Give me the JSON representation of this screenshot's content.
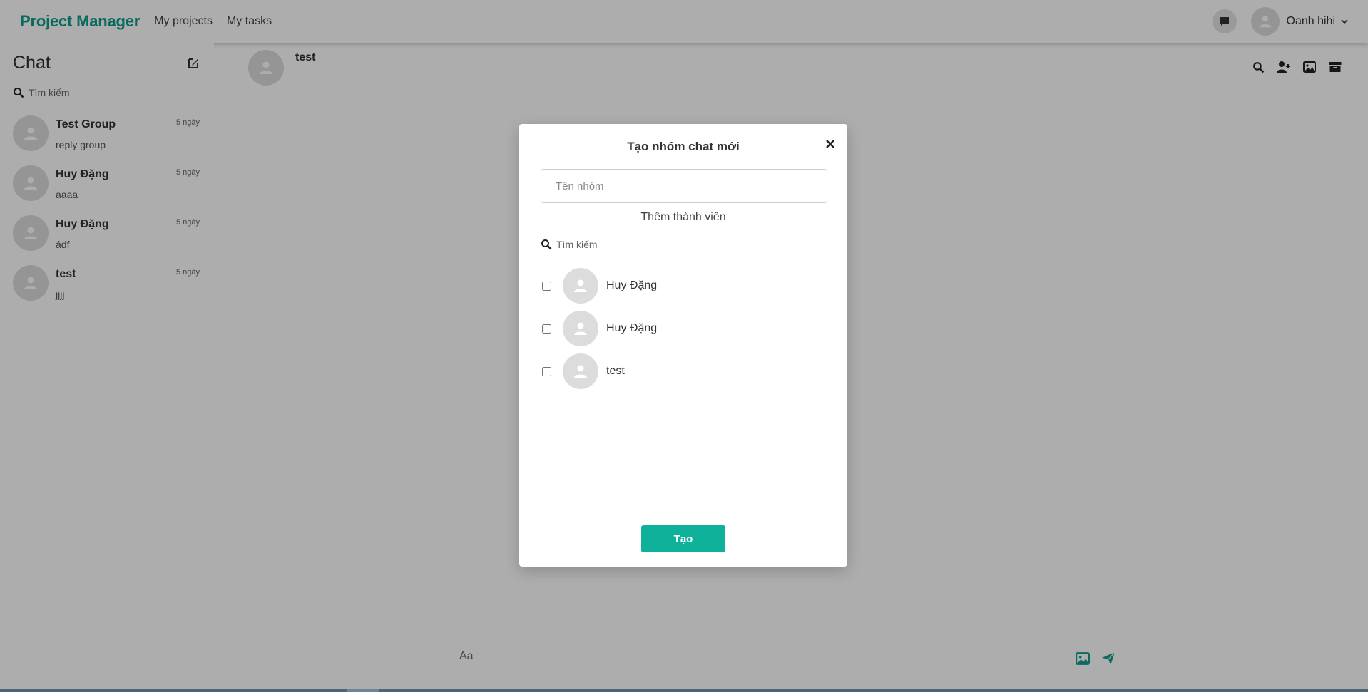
{
  "app": {
    "brand": "Project Manager"
  },
  "nav": {
    "links": [
      {
        "label": "My projects"
      },
      {
        "label": "My tasks"
      }
    ],
    "user_name": "Oanh hihi"
  },
  "sidebar": {
    "title": "Chat",
    "search_label": "Tìm kiếm",
    "conversations": [
      {
        "name": "Test Group",
        "last_message": "reply group",
        "time": "5 ngày"
      },
      {
        "name": "Huy Đặng",
        "last_message": "aaaa",
        "time": "5 ngày"
      },
      {
        "name": "Huy Đặng",
        "last_message": "ádf",
        "time": "5 ngày"
      },
      {
        "name": "test",
        "last_message": "jjjj",
        "time": "5 ngày"
      }
    ]
  },
  "chat": {
    "header_name": "test",
    "composer_placeholder": "Aa"
  },
  "modal": {
    "title": "Tạo nhóm chat mới",
    "group_name_placeholder": "Tên nhóm",
    "add_members_label": "Thêm thành viên",
    "search_label": "Tìm kiếm",
    "members": [
      {
        "name": "Huy Đặng",
        "checked": false
      },
      {
        "name": "Huy Đặng",
        "checked": false
      },
      {
        "name": "test",
        "checked": false
      }
    ],
    "create_label": "Tạo"
  },
  "colors": {
    "brand": "#0f9d8a",
    "accent": "#0fb19a",
    "overlay": "rgba(0,0,0,0.32)"
  },
  "icons": {
    "chat_button": "message-icon",
    "compose": "edit-icon",
    "search": "search-icon",
    "add_user": "user-plus-icon",
    "image": "image-icon",
    "archive": "archive-icon",
    "send": "send-icon",
    "close": "close-icon",
    "caret": "chevron-down-icon",
    "avatar": "user-avatar-icon"
  }
}
